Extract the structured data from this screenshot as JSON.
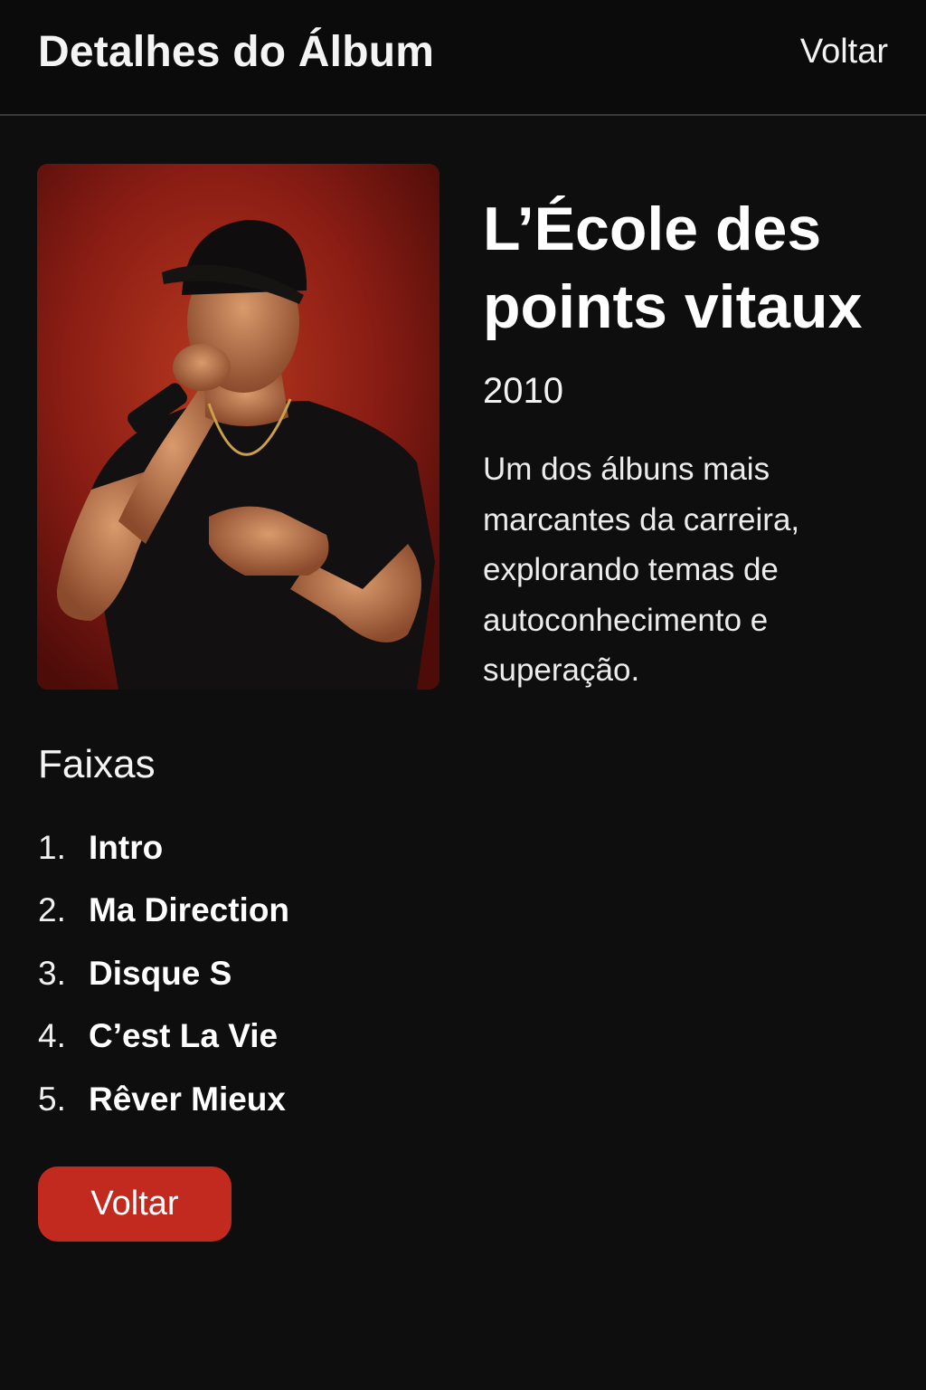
{
  "header": {
    "title": "Detalhes do Álbum",
    "back_link": "Voltar"
  },
  "album": {
    "title": "L’École des points vitaux",
    "year": "2010",
    "description": "Um dos álbuns mais marcantes da carreira, explorando temas de autoconhecimento e superação."
  },
  "tracks": {
    "heading": "Faixas",
    "items": [
      {
        "number": "1.",
        "name": "Intro"
      },
      {
        "number": "2.",
        "name": "Ma Direction"
      },
      {
        "number": "3.",
        "name": "Disque S"
      },
      {
        "number": "4.",
        "name": "C’est La Vie"
      },
      {
        "number": "5.",
        "name": "Rêver Mieux"
      }
    ]
  },
  "footer": {
    "back_button": "Voltar"
  },
  "colors": {
    "background": "#0e0e0f",
    "accent": "#c22a1f",
    "text": "#ffffff"
  }
}
